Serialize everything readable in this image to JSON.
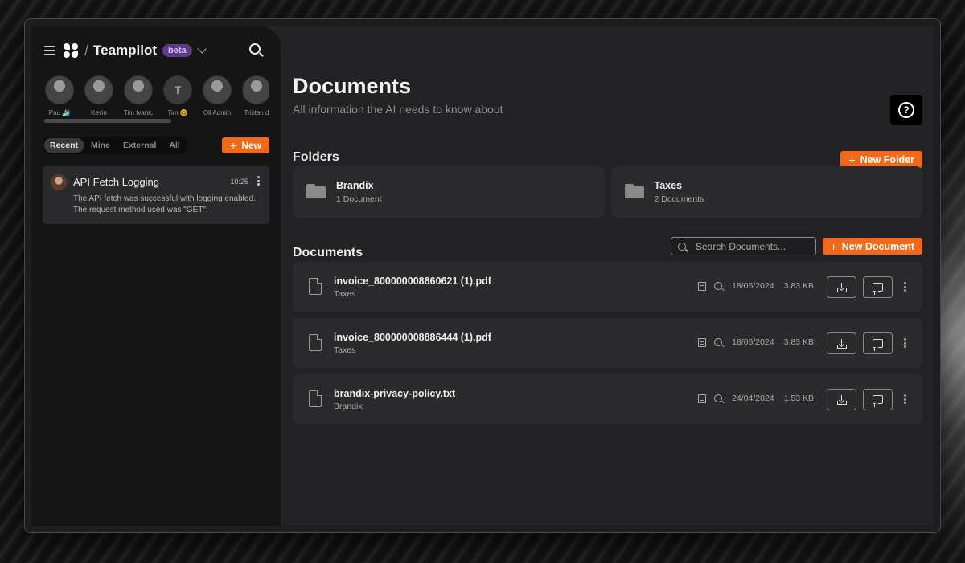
{
  "app": {
    "brand": "Teampilot",
    "badge": "beta"
  },
  "sidebar": {
    "avatars": [
      {
        "name": "Pau 🏄",
        "initial": ""
      },
      {
        "name": "Kevin",
        "initial": ""
      },
      {
        "name": "Tim Ivanic",
        "initial": ""
      },
      {
        "name": "Tim 🤓",
        "initial": "T"
      },
      {
        "name": "Oli Admin",
        "initial": ""
      },
      {
        "name": "Tristan d",
        "initial": ""
      }
    ],
    "tabs": [
      "Recent",
      "Mine",
      "External",
      "All"
    ],
    "active_tab": "Recent",
    "new_label": "New",
    "chats": [
      {
        "title": "API Fetch Logging",
        "time": "10:25",
        "preview": "The API fetch was successful with logging enabled. The request method used was \"GET\"."
      }
    ]
  },
  "main": {
    "title": "Documents",
    "subtitle": "All information the AI needs to know about",
    "help_icon": "question-circle-icon",
    "folders_title": "Folders",
    "new_folder_label": "New Folder",
    "folders": [
      {
        "name": "Brandix",
        "count": "1 Document"
      },
      {
        "name": "Taxes",
        "count": "2 Documents"
      }
    ],
    "documents_title": "Documents",
    "search_placeholder": "Search Documents...",
    "new_document_label": "New Document",
    "documents": [
      {
        "name": "invoice_800000008860621 (1).pdf",
        "folder": "Taxes",
        "date": "18/06/2024",
        "size": "3.83 KB"
      },
      {
        "name": "invoice_800000008886444 (1).pdf",
        "folder": "Taxes",
        "date": "18/06/2024",
        "size": "3.83 KB"
      },
      {
        "name": "brandix-privacy-policy.txt",
        "folder": "Brandix",
        "date": "24/04/2024",
        "size": "1.53 KB"
      }
    ]
  },
  "colors": {
    "accent": "#f26718",
    "badge_bg": "#5b3d8a"
  }
}
